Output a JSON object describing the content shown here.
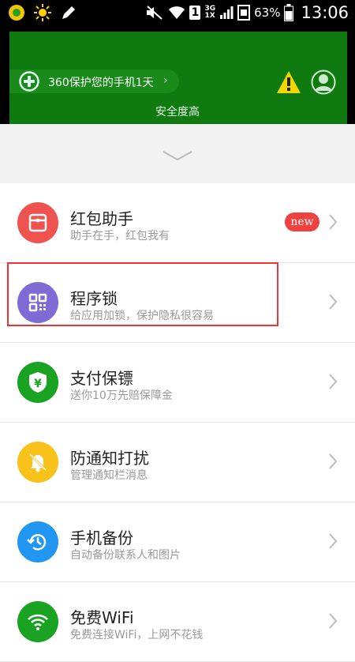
{
  "status_bar": {
    "battery_percent": "63%",
    "time": "13:06",
    "network_3g": "3G",
    "network_1x": "1X",
    "sim": "1",
    "icons": [
      "app-notification-icon",
      "brightness-icon",
      "edit-icon",
      "mute-icon",
      "wifi-icon",
      "signal-icon",
      "battery-icon"
    ]
  },
  "header": {
    "protect_text": "360保护您的手机1天",
    "protect_arrow": "›",
    "safety_status": "安全度高",
    "colors": {
      "green": "#0f7a0f",
      "warning": "#f2d600"
    }
  },
  "items": [
    {
      "title": "红包助手",
      "subtitle": "助手在手，红包我有",
      "badge": "new",
      "icon": "red-packet-icon",
      "color": "#ef5350"
    },
    {
      "title": "程序锁",
      "subtitle": "给应用加锁，保护隐私很容易",
      "icon": "app-lock-icon",
      "color": "#7e6bd6"
    },
    {
      "title": "支付保镖",
      "subtitle": "送你10万先赔保障金",
      "icon": "payment-shield-icon",
      "color": "#1aa323"
    },
    {
      "title": "防通知打扰",
      "subtitle": "管理通知栏消息",
      "icon": "notification-bell-icon",
      "color": "#f8c21a"
    },
    {
      "title": "手机备份",
      "subtitle": "自动备份联系人和图片",
      "icon": "backup-clock-icon",
      "color": "#2196f3"
    },
    {
      "title": "免费WiFi",
      "subtitle": "免费连接WiFi，上网不花钱",
      "icon": "wifi-icon",
      "color": "#1aa323"
    }
  ]
}
